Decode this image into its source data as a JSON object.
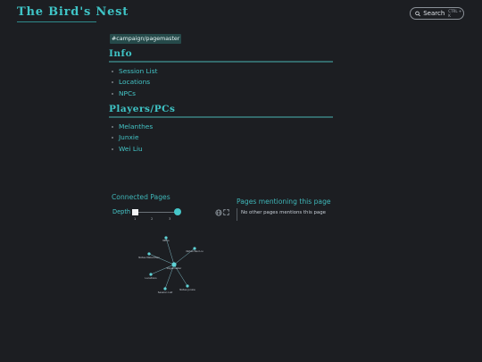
{
  "header": {
    "site_title": "The Bird's Nest",
    "search": {
      "label": "Search",
      "shortcut": "CTRL + K"
    }
  },
  "page": {
    "tag": "#campaign/pagemaster",
    "sections": [
      {
        "heading": "Info",
        "items": [
          "Session List",
          "Locations",
          "NPCs"
        ]
      },
      {
        "heading": "Players/PCs",
        "items": [
          "Melanthes",
          "Junxie",
          "Wei Liu"
        ]
      }
    ]
  },
  "connected_pages": {
    "title": "Connected Pages",
    "depth_label": "Depth",
    "depth_ticks": [
      "1",
      "2",
      "3"
    ],
    "depth_value": 3,
    "graph": {
      "center": "Pagemaster",
      "nodes": [
        "NPCs",
        "Notes Wei Liu",
        "Notes Melanthes",
        "Locations",
        "Session List",
        "Notes Junxie"
      ]
    }
  },
  "mentions": {
    "title": "Pages mentioning this page",
    "empty_text": "No other pages mentions this page"
  },
  "icons": {
    "search": "search-icon",
    "globe": "globe-icon",
    "expand": "expand-icon",
    "bullet": "bullet-icon"
  },
  "colors": {
    "background": "#1c1e22",
    "accent": "#3fc4c6",
    "tag_bg": "#264a4a"
  }
}
